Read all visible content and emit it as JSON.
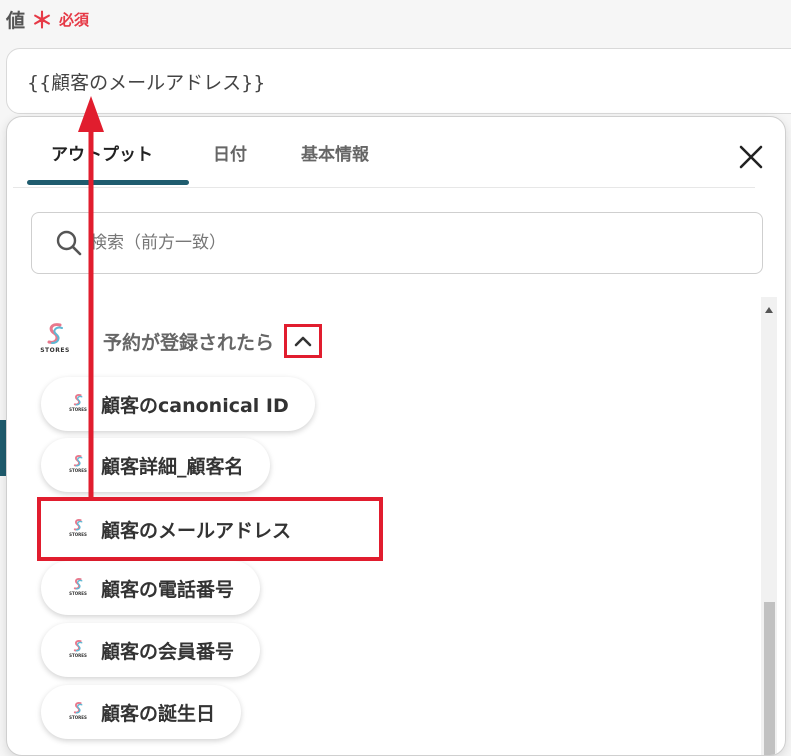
{
  "field": {
    "label": "値",
    "required_mark": "＊",
    "required_text": "必須",
    "value": "{{顧客のメールアドレス}}"
  },
  "panel": {
    "tabs": [
      {
        "label": "アウトプット",
        "active": true
      },
      {
        "label": "日付",
        "active": false
      },
      {
        "label": "基本情報",
        "active": false
      }
    ],
    "close_icon": "close-icon",
    "search": {
      "placeholder": "検索（前方一致）",
      "value": ""
    },
    "group": {
      "title": "予約が登録されたら",
      "logo_text": "STORES",
      "expanded": true
    },
    "items": [
      {
        "label": "顧客のcanonical ID",
        "logo_text": "STORES"
      },
      {
        "label": "顧客詳細_顧客名",
        "logo_text": "STORES"
      },
      {
        "label": "顧客のメールアドレス",
        "logo_text": "STORES",
        "highlighted": true
      },
      {
        "label": "顧客の電話番号",
        "logo_text": "STORES"
      },
      {
        "label": "顧客の会員番号",
        "logo_text": "STORES"
      },
      {
        "label": "顧客の誕生日",
        "logo_text": "STORES"
      }
    ]
  },
  "colors": {
    "accent": "#1f5c6e",
    "required": "#e63946",
    "highlight": "#e11d2e"
  }
}
